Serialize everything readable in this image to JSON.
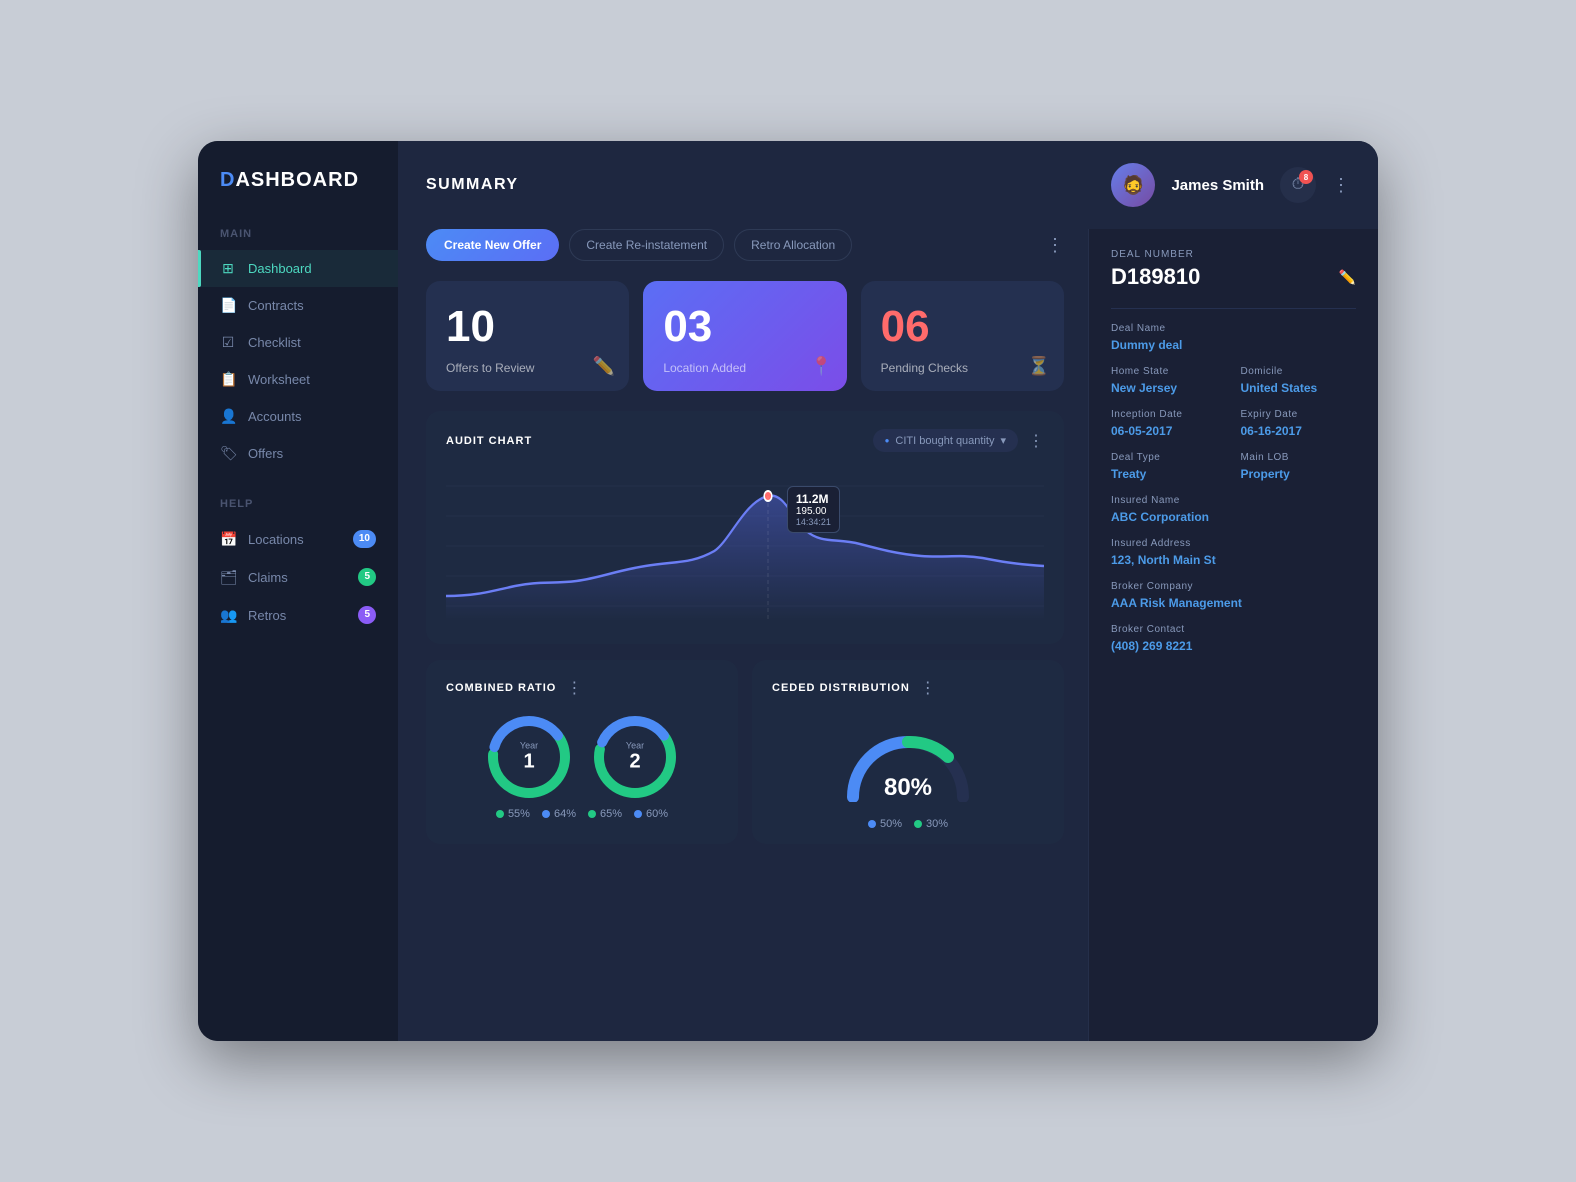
{
  "app": {
    "name": "DASHBOARD",
    "name_d": "D",
    "name_rest": "ASHBOARD"
  },
  "header": {
    "title": "SUMMARY",
    "user_name": "James Smith",
    "notification_count": "8"
  },
  "sidebar": {
    "main_label": "Main",
    "help_label": "Help",
    "items_main": [
      {
        "label": "Dashboard",
        "active": true,
        "icon": "⊞"
      },
      {
        "label": "Contracts",
        "active": false,
        "icon": "📄"
      },
      {
        "label": "Checklist",
        "active": false,
        "icon": "☑"
      },
      {
        "label": "Worksheet",
        "active": false,
        "icon": "📋"
      },
      {
        "label": "Accounts",
        "active": false,
        "icon": "👤"
      },
      {
        "label": "Offers",
        "active": false,
        "icon": "🏷"
      }
    ],
    "items_help": [
      {
        "label": "Locations",
        "badge": "10",
        "badge_color": "blue",
        "icon": "📅"
      },
      {
        "label": "Claims",
        "badge": "5",
        "badge_color": "green",
        "icon": "🗂"
      },
      {
        "label": "Retros",
        "badge": "5",
        "badge_color": "purple",
        "icon": "👥"
      }
    ]
  },
  "toolbar": {
    "btn_create_offer": "Create New Offer",
    "btn_reinstatement": "Create Re-instatement",
    "btn_retro": "Retro Allocation"
  },
  "stat_cards": [
    {
      "number": "10",
      "label": "Offers to Review",
      "highlight": false,
      "number_color": "white"
    },
    {
      "number": "03",
      "label": "Location Added",
      "highlight": true,
      "number_color": "white"
    },
    {
      "number": "06",
      "label": "Pending Checks",
      "highlight": false,
      "number_color": "red"
    }
  ],
  "audit_chart": {
    "title_prefix": "AUDIT ",
    "title_bold": "CHART",
    "filter_label": "CITI bought quantity",
    "tooltip": {
      "value": "11.2M",
      "sub": "195.00",
      "time": "14:34:21"
    }
  },
  "combined_ratio": {
    "title_prefix": "COMBINED ",
    "title_bold": "RATIO",
    "year1": {
      "label": "Year",
      "num": "1",
      "val1": 55,
      "val2": 64
    },
    "year2": {
      "label": "Year",
      "num": "2",
      "val1": 65,
      "val2": 60
    },
    "legend1_label": "55%",
    "legend2_label": "64%",
    "legend3_label": "65%",
    "legend4_label": "60%"
  },
  "ceded_distribution": {
    "title_prefix": "CEDED ",
    "title_bold": "DISTRIBUTION",
    "percent": "80%",
    "legend1": "50%",
    "legend2": "30%"
  },
  "deal": {
    "number_label": "DEAL NUMBER",
    "number": "D189810",
    "name_label": "Deal Name",
    "name": "Dummy deal",
    "home_state_label": "Home State",
    "home_state": "New Jersey",
    "domicile_label": "Domicile",
    "domicile": "United States",
    "inception_label": "Inception Date",
    "inception": "06-05-2017",
    "expiry_label": "Expiry Date",
    "expiry": "06-16-2017",
    "deal_type_label": "Deal Type",
    "deal_type": "Treaty",
    "main_lob_label": "Main LOB",
    "main_lob": "Property",
    "insured_name_label": "Insured Name",
    "insured_name": "ABC Corporation",
    "insured_addr_label": "Insured Address",
    "insured_addr": "123, North Main St",
    "broker_company_label": "Broker Company",
    "broker_company": "AAA Risk Management",
    "broker_contact_label": "Broker Contact",
    "broker_contact": "(408) 269 8221"
  }
}
